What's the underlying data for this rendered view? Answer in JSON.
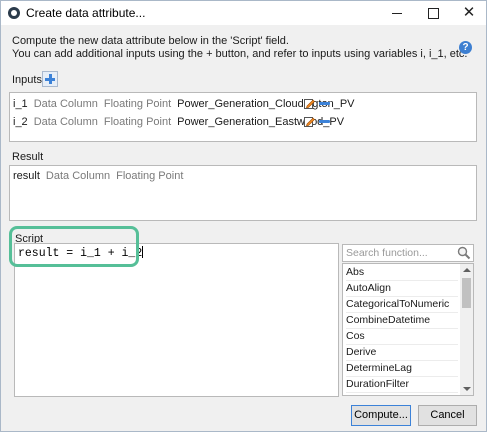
{
  "window": {
    "title": "Create data attribute...",
    "close_glyph": "✕"
  },
  "description": {
    "line1": "Compute the new data attribute below in the 'Script' field.",
    "line2": "You can add additional inputs using the + button, and refer to inputs using variables i, i_1, etc."
  },
  "help_label": "?",
  "inputs": {
    "label": "Inputs",
    "rows": [
      {
        "id": "i_1",
        "kind": "Data Column",
        "type": "Floating Point",
        "name": "Power_Generation_Cloudington_PV"
      },
      {
        "id": "i_2",
        "kind": "Data Column",
        "type": "Floating Point",
        "name": "Power_Generation_Eastwood_PV"
      }
    ]
  },
  "result": {
    "label": "Result",
    "id": "result",
    "kind": "Data Column",
    "type": "Floating Point"
  },
  "script": {
    "label": "Script",
    "code": "result = i_1 + i_2"
  },
  "functions": {
    "search_placeholder": "Search function...",
    "items": [
      "Abs",
      "AutoAlign",
      "CategoricalToNumeric",
      "CombineDatetime",
      "Cos",
      "Derive",
      "DetermineLag",
      "DurationFilter"
    ]
  },
  "buttons": {
    "compute": "Compute...",
    "cancel": "Cancel"
  },
  "colors": {
    "accent": "#3c82d8",
    "highlight": "#56bf98"
  }
}
